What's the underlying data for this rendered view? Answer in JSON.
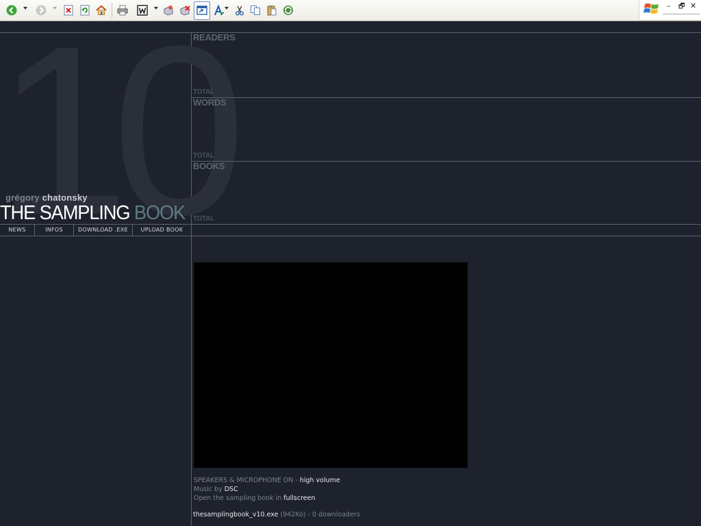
{
  "toolbar": {
    "buttons": [
      {
        "name": "back-icon",
        "has_arrow": true
      },
      {
        "name": "forward-icon",
        "has_arrow": true
      },
      {
        "name": "stop-icon"
      },
      {
        "name": "refresh-icon"
      },
      {
        "name": "home-icon"
      },
      {
        "name": "print-icon"
      },
      {
        "name": "edit-word-icon",
        "has_arrow": true
      },
      {
        "name": "send-icon"
      },
      {
        "name": "delete-icon"
      },
      {
        "name": "new-window-icon"
      },
      {
        "name": "font-size-icon",
        "has_arrow": true
      },
      {
        "name": "cut-icon"
      },
      {
        "name": "copy-icon"
      },
      {
        "name": "paste-icon"
      },
      {
        "name": "sync-icon"
      }
    ],
    "window_controls": {
      "minimize": "–",
      "restore": "🗗",
      "close": "✕"
    }
  },
  "logo": {
    "number": "10",
    "author_first": "grégory",
    "author_last": "chatonsky",
    "title_main": "THE SAMPLING ",
    "title_accent": "BOOK"
  },
  "nav": [
    {
      "label": "NEWS"
    },
    {
      "label": "INFOS"
    },
    {
      "label": "DOWNLOAD .EXE"
    },
    {
      "label": "UPLOAD BOOK"
    }
  ],
  "stats": [
    {
      "label": "READERS",
      "total": "TOTAL"
    },
    {
      "label": "WORDS",
      "total": "TOTAL"
    },
    {
      "label": "BOOKS",
      "total": "TOTAL"
    }
  ],
  "info": {
    "line1_prefix": "SPEAKERS & MICROPHONE ON - ",
    "line1_highlight": "high volume",
    "line2_prefix": "Music by ",
    "line2_link": "DSC",
    "line3_prefix": "Open the sampling book in ",
    "line3_link": "fullscreen",
    "download_file": "thesamplingbook_v10.exe",
    "download_size": " (942Ko)",
    "download_count": " - 0 downloaders"
  },
  "colors": {
    "background": "#1e222c",
    "rule": "#5b6270",
    "accent": "#5e7a84",
    "video": "#000000"
  }
}
